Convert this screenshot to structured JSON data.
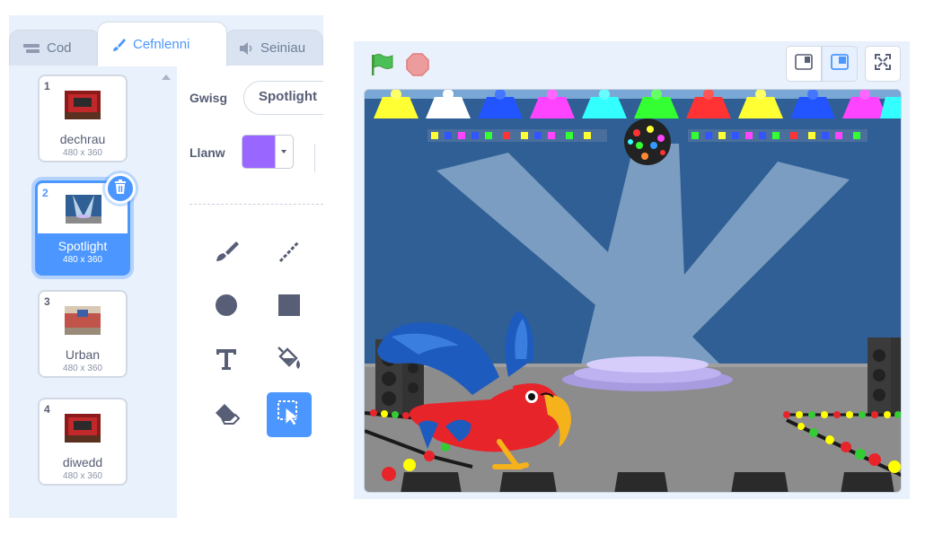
{
  "tabs": [
    {
      "label": "Cod",
      "icon": "code-icon",
      "active": false
    },
    {
      "label": "Cefnlenni",
      "icon": "paintbrush-icon",
      "active": true
    },
    {
      "label": "Seiniau",
      "icon": "speaker-icon",
      "active": false
    }
  ],
  "backdrops": [
    {
      "number": "1",
      "name": "dechrau",
      "size": "480 x 360",
      "selected": false
    },
    {
      "number": "2",
      "name": "Spotlight",
      "size": "480 x 360",
      "selected": true
    },
    {
      "number": "3",
      "name": "Urban",
      "size": "480 x 360",
      "selected": false
    },
    {
      "number": "4",
      "name": "diwedd",
      "size": "480 x 360",
      "selected": false
    }
  ],
  "paint_editor": {
    "costume_label": "Gwisg",
    "costume_name": "Spotlight",
    "fill_label": "Llanw",
    "fill_color": "#9966ff",
    "tools": [
      "brush-icon",
      "line-icon",
      "circle-icon",
      "rectangle-icon",
      "text-icon",
      "fill-icon",
      "eraser-icon",
      "select-icon"
    ],
    "active_tool": "select-icon"
  },
  "stage_controls": {
    "green_flag": "green-flag-icon",
    "stop": "stop-icon",
    "layout_buttons": [
      "small-stage-icon",
      "normal-stage-icon",
      "fullscreen-icon"
    ],
    "active_layout": "normal-stage-icon"
  },
  "colors": {
    "accent": "#4c97ff",
    "panel_bg": "#e9f1fc",
    "stage_wall": "#2f5f94",
    "parrot": "#e8242b"
  }
}
